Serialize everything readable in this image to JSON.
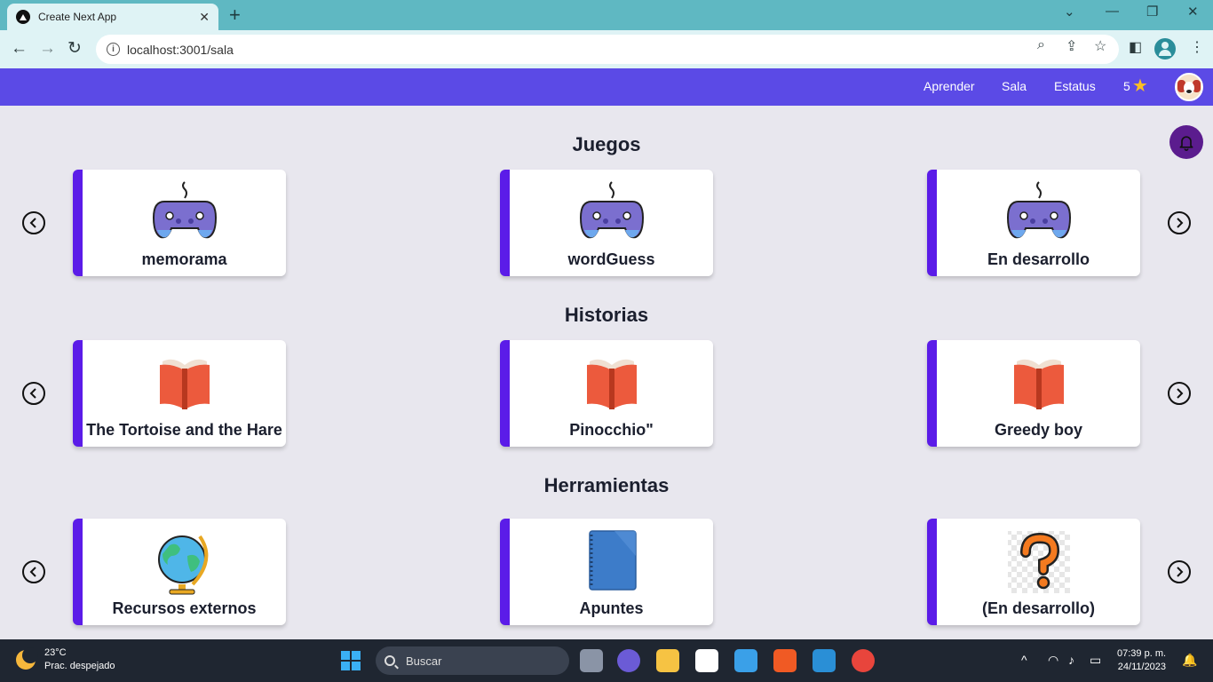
{
  "browser": {
    "tab_title": "Create Next App",
    "url": "localhost:3001/sala"
  },
  "nav": {
    "links": [
      "Aprender",
      "Sala",
      "Estatus"
    ],
    "stars_count": "5"
  },
  "sections": [
    {
      "title": "Juegos",
      "cards": [
        "memorama",
        "wordGuess",
        "En desarrollo"
      ]
    },
    {
      "title": "Historias",
      "cards": [
        "The Tortoise and the Hare",
        "Pinocchio\"",
        "Greedy boy"
      ]
    },
    {
      "title": "Herramientas",
      "cards": [
        "Recursos externos",
        "Apuntes",
        "(En desarrollo)"
      ]
    }
  ],
  "taskbar": {
    "weather_temp": "23°C",
    "weather_desc": "Prac. despejado",
    "search_placeholder": "Buscar",
    "time": "07:39 p. m.",
    "date": "24/11/2023"
  },
  "colors": {
    "nav_bg": "#5b4ae6",
    "card_accent": "#5b1ce8",
    "bell_bg": "#5b1c8e"
  }
}
